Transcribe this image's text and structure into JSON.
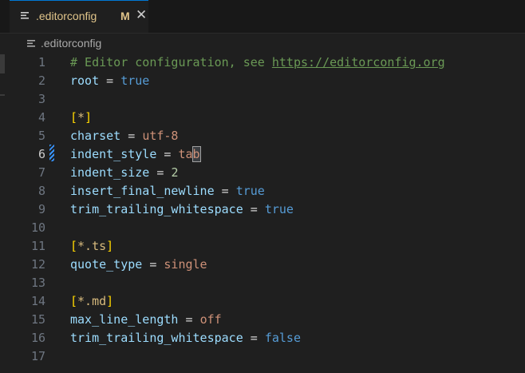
{
  "tab": {
    "filename": ".editorconfig",
    "modified": "M",
    "close_glyph": "✕",
    "icon": "lines-file-icon"
  },
  "breadcrumb": {
    "filename": ".editorconfig",
    "icon": "lines-file-icon"
  },
  "editor": {
    "active_line": 6,
    "lines": [
      {
        "n": "1",
        "comment_prefix": "# Editor configuration, see ",
        "link": "https://editorconfig.org"
      },
      {
        "n": "2",
        "key": "root",
        "op": " = ",
        "value": "true",
        "vtype": "bool"
      },
      {
        "n": "3"
      },
      {
        "n": "4",
        "b1": "[",
        "sec": "*",
        "b2": "]"
      },
      {
        "n": "5",
        "key": "charset",
        "op": " = ",
        "value": "utf-8",
        "vtype": "str"
      },
      {
        "n": "6",
        "key": "indent_style",
        "op": " = ",
        "value": "ta",
        "cursor_char": "b",
        "vtype": "str"
      },
      {
        "n": "7",
        "key": "indent_size",
        "op": " = ",
        "value": "2",
        "vtype": "num"
      },
      {
        "n": "8",
        "key": "insert_final_newline",
        "op": " = ",
        "value": "true",
        "vtype": "bool"
      },
      {
        "n": "9",
        "key": "trim_trailing_whitespace",
        "op": " = ",
        "value": "true",
        "vtype": "bool"
      },
      {
        "n": "10"
      },
      {
        "n": "11",
        "b1": "[",
        "sec": "*.ts",
        "b2": "]"
      },
      {
        "n": "12",
        "key": "quote_type",
        "op": " = ",
        "value": "single",
        "vtype": "str"
      },
      {
        "n": "13"
      },
      {
        "n": "14",
        "b1": "[",
        "sec": "*.md",
        "b2": "]"
      },
      {
        "n": "15",
        "key": "max_line_length",
        "op": " = ",
        "value": "off",
        "vtype": "str"
      },
      {
        "n": "16",
        "key": "trim_trailing_whitespace",
        "op": " = ",
        "value": "false",
        "vtype": "bool"
      },
      {
        "n": "17"
      }
    ]
  }
}
